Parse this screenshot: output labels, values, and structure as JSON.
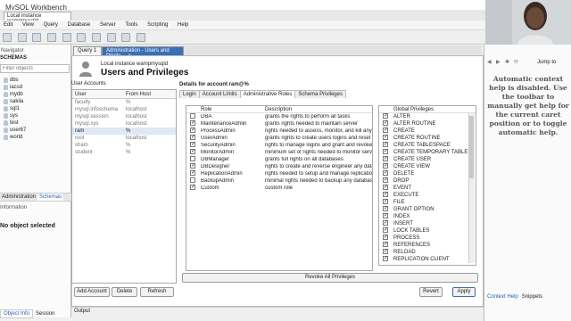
{
  "app": {
    "window_title": "MySQL Workbench",
    "connection_tab": "Local instance wampmysqld"
  },
  "menu": [
    "Edit",
    "View",
    "Query",
    "Database",
    "Server",
    "Tools",
    "Scripting",
    "Help"
  ],
  "navigator": {
    "title": "Navigator",
    "schemas_label": "SCHEMAS",
    "filter_placeholder": "Filter objects",
    "schemas": [
      "dbs",
      "iacsd",
      "mydb",
      "sakila",
      "sql1",
      "sys",
      "test",
      "user67",
      "world"
    ],
    "tabs": [
      "Administration",
      "Schemas"
    ],
    "info_label": "Information",
    "no_object": "No object selected",
    "bottom_tabs": [
      "Object Info",
      "Session"
    ]
  },
  "doc_tabs": {
    "query": "Query 1",
    "admin": "Administration - Users and Privile..."
  },
  "header": {
    "instance": "Local instance wampmysqld",
    "title": "Users and Privileges"
  },
  "user_accounts": {
    "label": "User Accounts",
    "col_user": "User",
    "col_host": "From Host",
    "rows": [
      {
        "user": "faculty",
        "host": "%"
      },
      {
        "user": "mysql.infoschema",
        "host": "localhost"
      },
      {
        "user": "mysql.session",
        "host": "localhost"
      },
      {
        "user": "mysql.sys",
        "host": "localhost"
      },
      {
        "user": "ram",
        "host": "%"
      },
      {
        "user": "root",
        "host": "localhost"
      },
      {
        "user": "sham",
        "host": "%"
      },
      {
        "user": "student",
        "host": "%"
      }
    ],
    "selected_index": 4,
    "buttons": {
      "add": "Add Account",
      "delete": "Delete",
      "refresh": "Refresh"
    }
  },
  "details": {
    "heading": "Details for account ram@%",
    "tabs": [
      "Login",
      "Account Limits",
      "Administrative Roles",
      "Schema Privileges"
    ],
    "selected_tab": 2,
    "roles_col_role": "Role",
    "roles_col_desc": "Description",
    "roles": [
      {
        "name": "DBA",
        "desc": "grants the rights to perform all tasks",
        "checked": false
      },
      {
        "name": "MaintenanceAdmin",
        "desc": "grants rights needed to maintain server",
        "checked": true
      },
      {
        "name": "ProcessAdmin",
        "desc": "rights needed to assess, monitor, and kill any us",
        "checked": true
      },
      {
        "name": "UserAdmin",
        "desc": "grants rights to create users logins and reset pa",
        "checked": true
      },
      {
        "name": "SecurityAdmin",
        "desc": "rights to manage logins and grant and revoke s",
        "checked": true
      },
      {
        "name": "MonitorAdmin",
        "desc": "minimum set of rights needed to monitor serve",
        "checked": true
      },
      {
        "name": "DBManager",
        "desc": "grants full rights on all databases",
        "checked": false
      },
      {
        "name": "DBDesigner",
        "desc": "rights to create and reverse engineer any datab",
        "checked": true
      },
      {
        "name": "ReplicationAdmin",
        "desc": "rights needed to setup and manage replication",
        "checked": true
      },
      {
        "name": "BackupAdmin",
        "desc": "minimal rights needed to backup any database",
        "checked": false
      },
      {
        "name": "Custom",
        "desc": "custom role",
        "checked": true
      }
    ],
    "priv_col": "Global Privileges",
    "privileges": [
      "ALTER",
      "ALTER ROUTINE",
      "CREATE",
      "CREATE ROUTINE",
      "CREATE TABLESPACE",
      "CREATE TEMPORARY TABLES",
      "CREATE USER",
      "CREATE VIEW",
      "DELETE",
      "DROP",
      "EVENT",
      "EXECUTE",
      "FILE",
      "GRANT OPTION",
      "INDEX",
      "INSERT",
      "LOCK TABLES",
      "PROCESS",
      "REFERENCES",
      "RELOAD",
      "REPLICATION CLIENT"
    ],
    "revoke_label": "Revoke All Privileges",
    "revert_label": "Revert",
    "apply_label": "Apply"
  },
  "output_label": "Output",
  "right_panel": {
    "jump_to": "Jump to",
    "help_text": "Automatic context help is disabled. Use the toolbar to manually get help for the current caret position or to toggle automatic help.",
    "tabs": [
      "Context Help",
      "Snippets"
    ]
  },
  "colors": {
    "accent": "#3b6fb6",
    "selection": "#dfe8f6"
  }
}
